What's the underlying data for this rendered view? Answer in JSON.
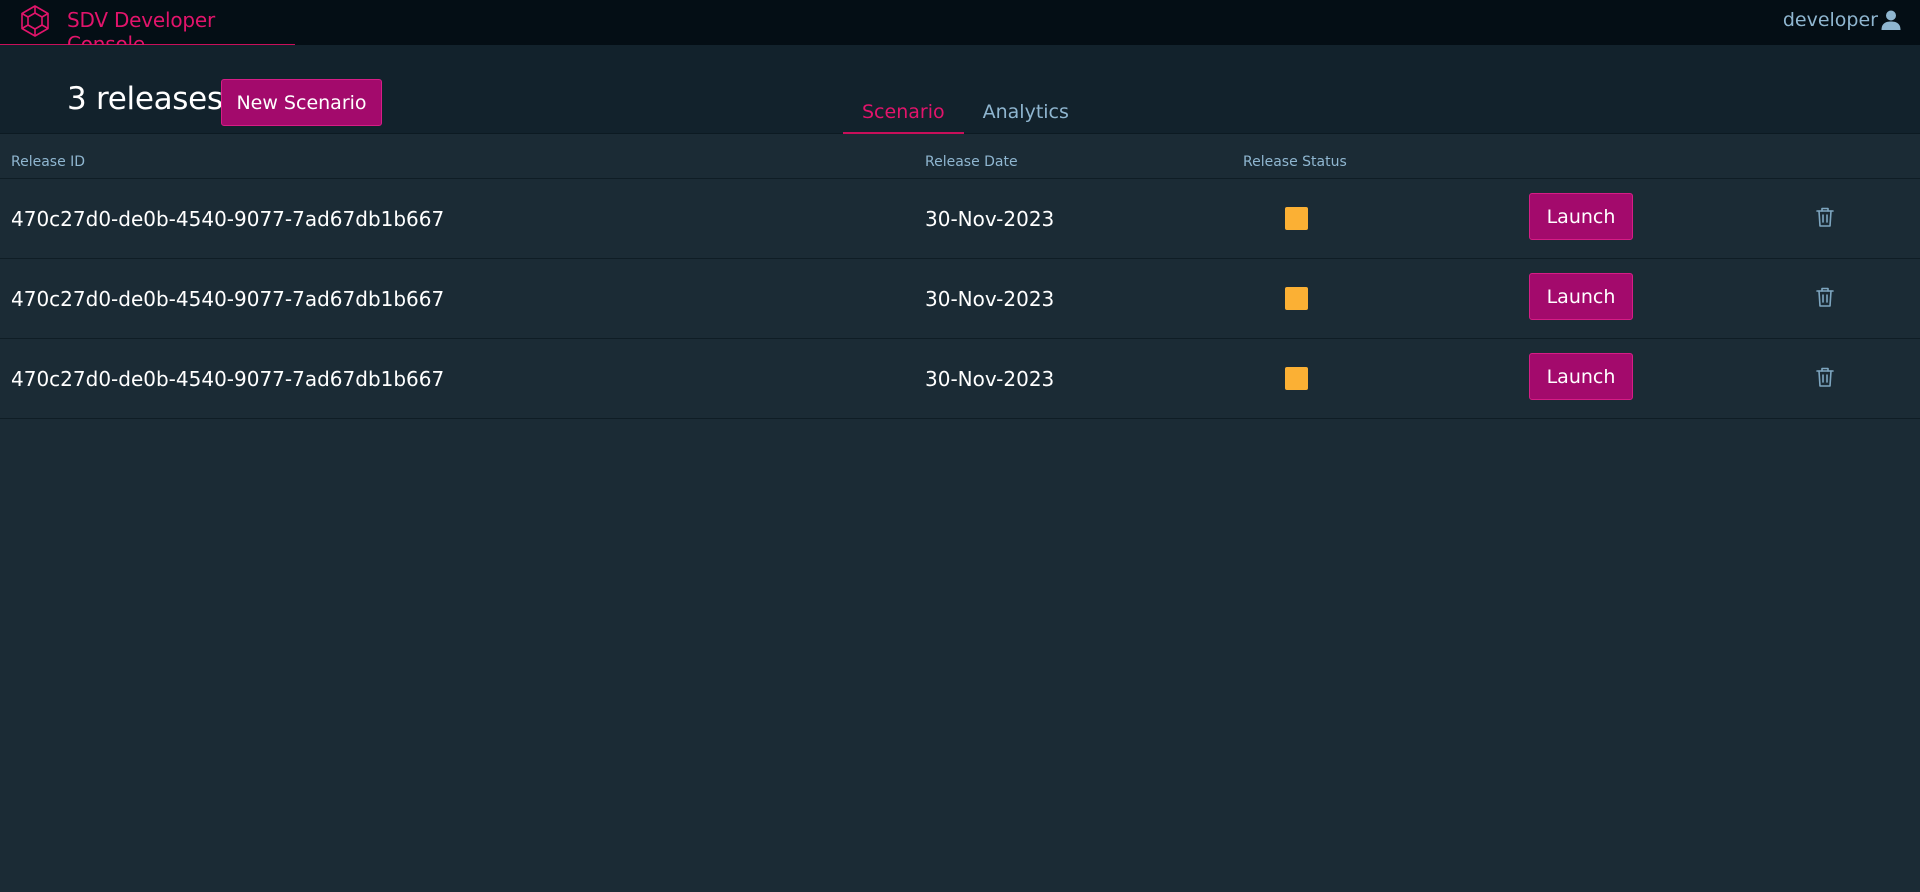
{
  "app": {
    "title": "SDV Developer Console",
    "user": "developer"
  },
  "header": {
    "release_count": "3 releases",
    "new_scenario_label": "New Scenario"
  },
  "tabs": [
    {
      "label": "Scenario",
      "active": true
    },
    {
      "label": "Analytics",
      "active": false
    }
  ],
  "table": {
    "columns": [
      "Release ID",
      "Release Date",
      "Release Status"
    ],
    "rows": [
      {
        "release_id": "470c27d0-de0b-4540-9077-7ad67db1b667",
        "release_date": "30-Nov-2023",
        "status_color": "#fbb034",
        "action": "Launch"
      },
      {
        "release_id": "470c27d0-de0b-4540-9077-7ad67db1b667",
        "release_date": "30-Nov-2023",
        "status_color": "#fbb034",
        "action": "Launch"
      },
      {
        "release_id": "470c27d0-de0b-4540-9077-7ad67db1b667",
        "release_date": "30-Nov-2023",
        "status_color": "#fbb034",
        "action": "Launch"
      }
    ]
  },
  "icons": {
    "logo": "cube-logo-icon",
    "user": "user-icon",
    "delete": "trash-icon"
  },
  "colors": {
    "accent": "#e2146b",
    "button": "#a30a6c",
    "muted": "#8fb6d0",
    "background": "#1b2b35",
    "topbar": "#040e15"
  }
}
